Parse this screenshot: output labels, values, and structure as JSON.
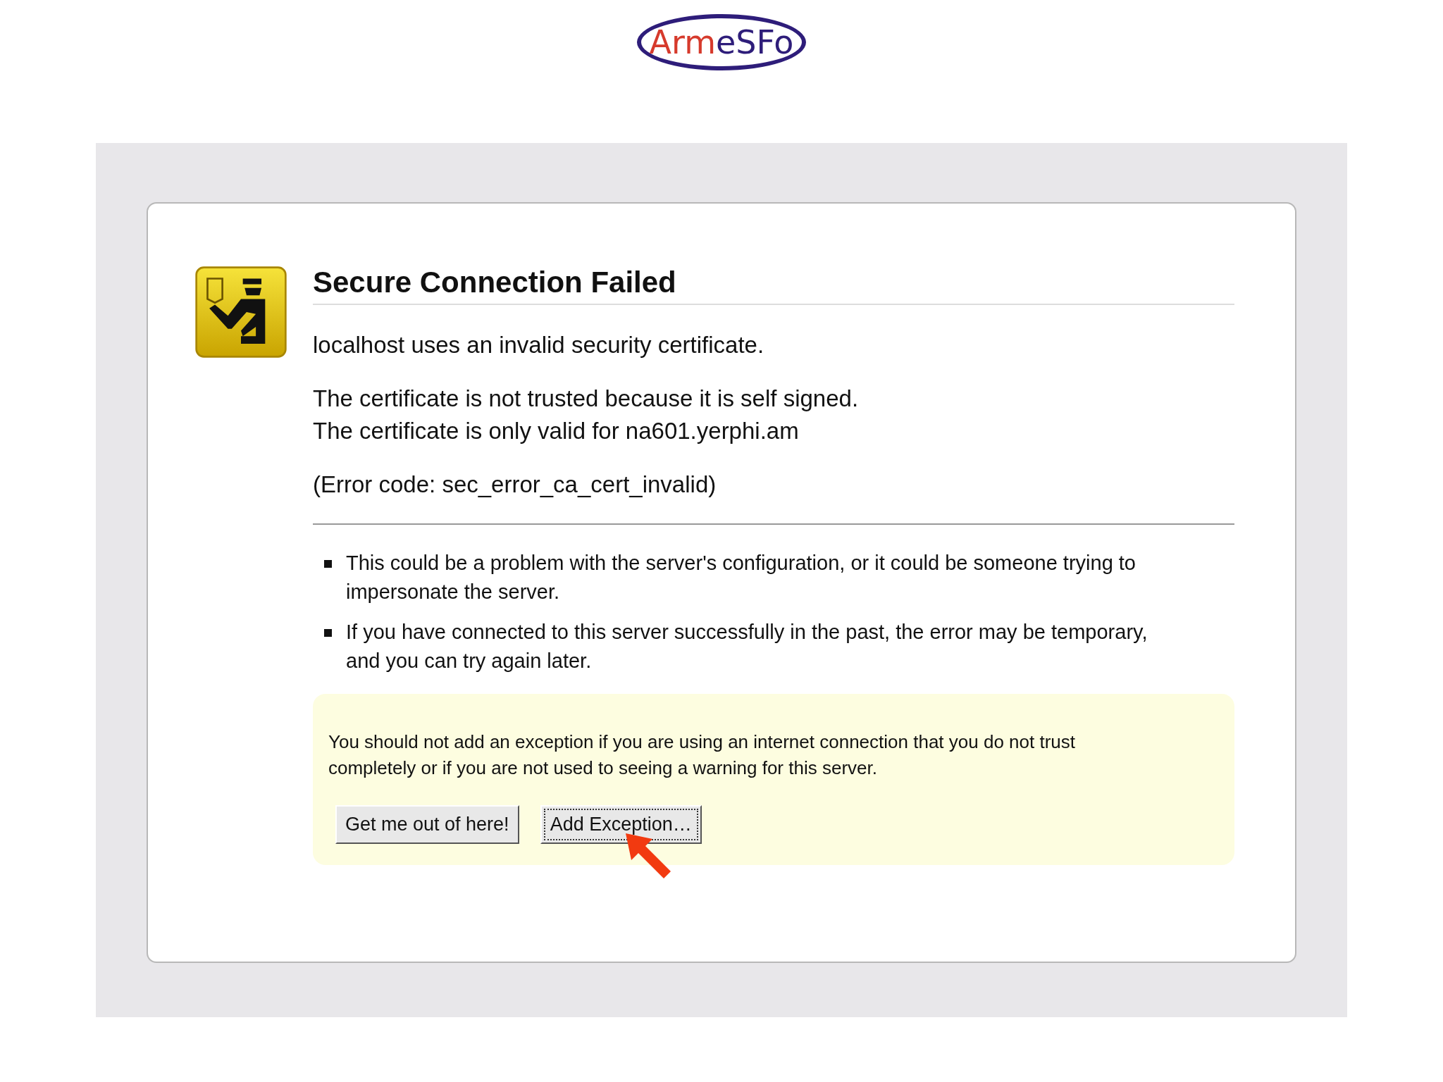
{
  "logo": {
    "parts": [
      {
        "text": "Arm",
        "color": "#d63a2c"
      },
      {
        "text": "eSFo",
        "color": "#2e1d7a"
      }
    ]
  },
  "error_page": {
    "title": "Secure Connection Failed",
    "message": "localhost uses an invalid security certificate.",
    "details": [
      "The certificate is not trusted because it is self signed.",
      "The certificate is only valid for na601.yerphi.am"
    ],
    "error_code": "(Error code: sec_error_ca_cert_invalid)",
    "bullets": [
      "This could be a problem with the server's configuration, or it could be someone trying to impersonate the server.",
      "If you have connected to this server successfully in the past, the error may be temporary, and you can try again later."
    ],
    "warning": {
      "text": "You should not add an exception if you are using an internet connection that you do not trust completely or if you are not used to seeing a warning for this server.",
      "buttons": [
        {
          "label": "Get me out of here!",
          "selected": false
        },
        {
          "label": "Add Exception…",
          "selected": true
        }
      ]
    }
  }
}
